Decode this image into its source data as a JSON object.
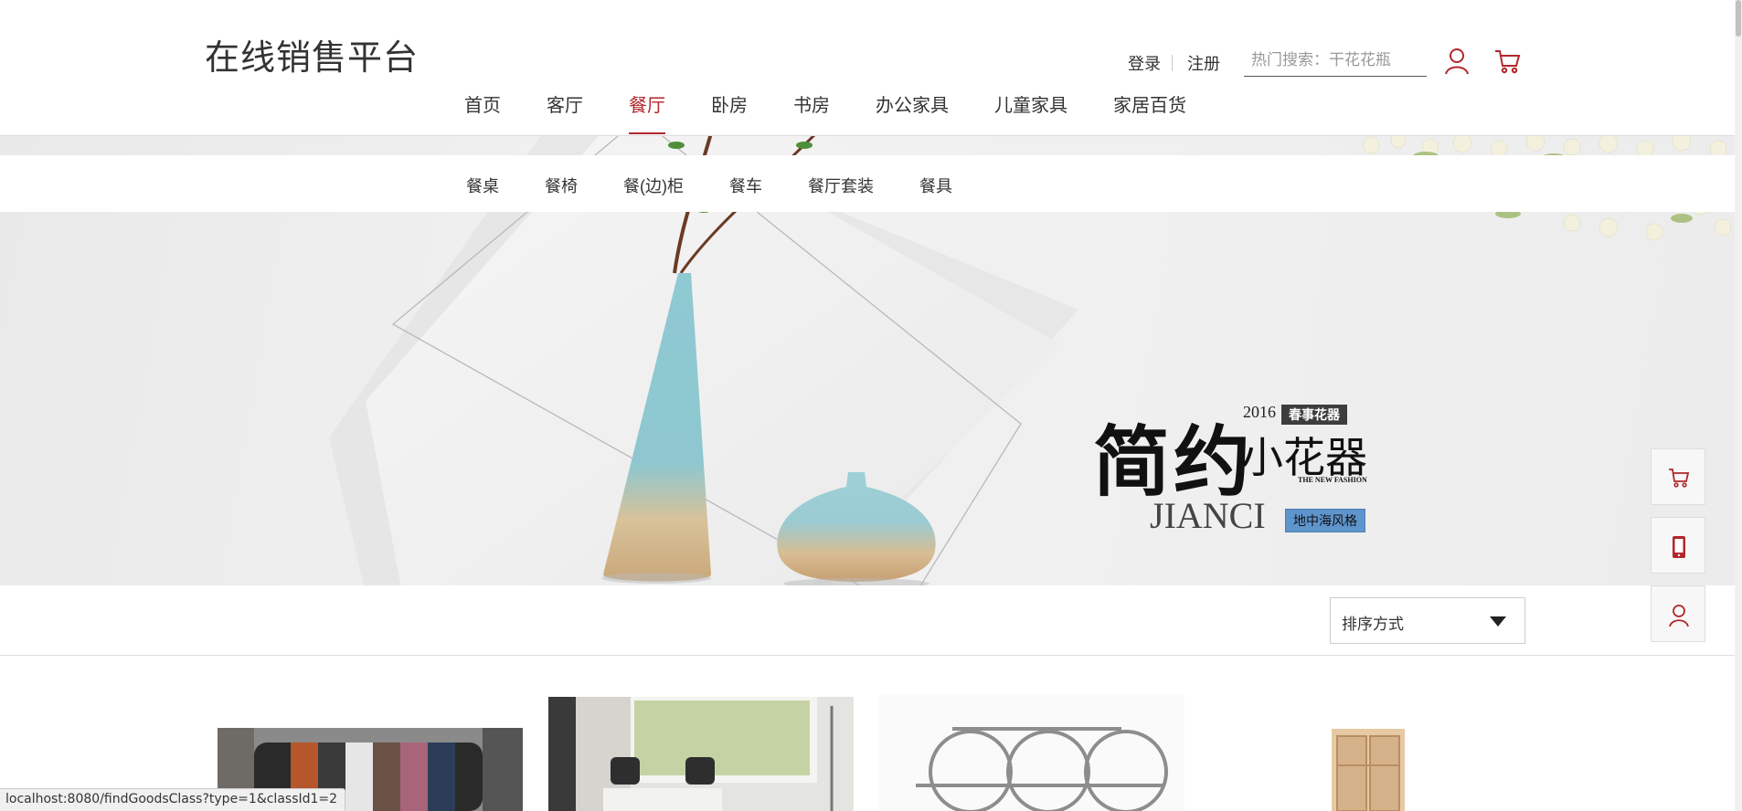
{
  "header": {
    "logo": "在线销售平台",
    "login": "登录",
    "register": "注册",
    "search_placeholder": "热门搜索：干花花瓶",
    "user_icon": "user-icon",
    "cart_icon": "cart-icon",
    "accent_color": "#b3262b"
  },
  "nav": {
    "items": [
      "首页",
      "客厅",
      "餐厅",
      "卧房",
      "书房",
      "办公家具",
      "儿童家具",
      "家居百货"
    ],
    "active": "餐厅"
  },
  "subnav": {
    "items": [
      "餐桌",
      "餐椅",
      "餐(边)柜",
      "餐车",
      "餐厅套装",
      "餐具"
    ]
  },
  "banner": {
    "main_text": "简约",
    "year": "2016",
    "tag1": "春事花器",
    "sub_text": "小花器",
    "fashion": "THE NEW FASHION",
    "brand": "JIANCI",
    "tag2": "地中海风格"
  },
  "sort": {
    "label": "排序方式"
  },
  "side": {
    "cart_icon": "cart-icon",
    "phone_icon": "phone-icon",
    "user_icon": "user-icon"
  },
  "status": {
    "url": "localhost:8080/findGoodsClass?type=1&classId1=2"
  }
}
